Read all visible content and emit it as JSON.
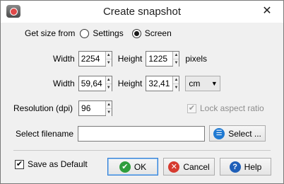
{
  "window": {
    "title": "Create snapshot",
    "close_glyph": "✕",
    "icon": "camera-app-icon"
  },
  "size_source": {
    "label": "Get size from",
    "options": [
      {
        "label": "Settings",
        "checked": false
      },
      {
        "label": "Screen",
        "checked": true
      }
    ]
  },
  "pixel_size": {
    "width_label": "Width",
    "width_value": "2254",
    "height_label": "Height",
    "height_value": "1225",
    "unit_label": "pixels"
  },
  "physical_size": {
    "width_label": "Width",
    "width_value": "59,64",
    "height_label": "Height",
    "height_value": "32,41",
    "unit_selected": "cm"
  },
  "resolution": {
    "label": "Resolution (dpi)",
    "value": "96"
  },
  "aspect": {
    "label": "Lock aspect ratio",
    "checked": true,
    "enabled": false
  },
  "filename": {
    "label": "Select filename",
    "value": "",
    "button_label": "Select ..."
  },
  "footer": {
    "save_default_label": "Save as Default",
    "save_default_checked": true,
    "ok_label": "OK",
    "cancel_label": "Cancel",
    "help_label": "Help"
  },
  "spinner_glyphs": {
    "up": "▲",
    "down": "▼"
  },
  "check_glyph": "✔"
}
